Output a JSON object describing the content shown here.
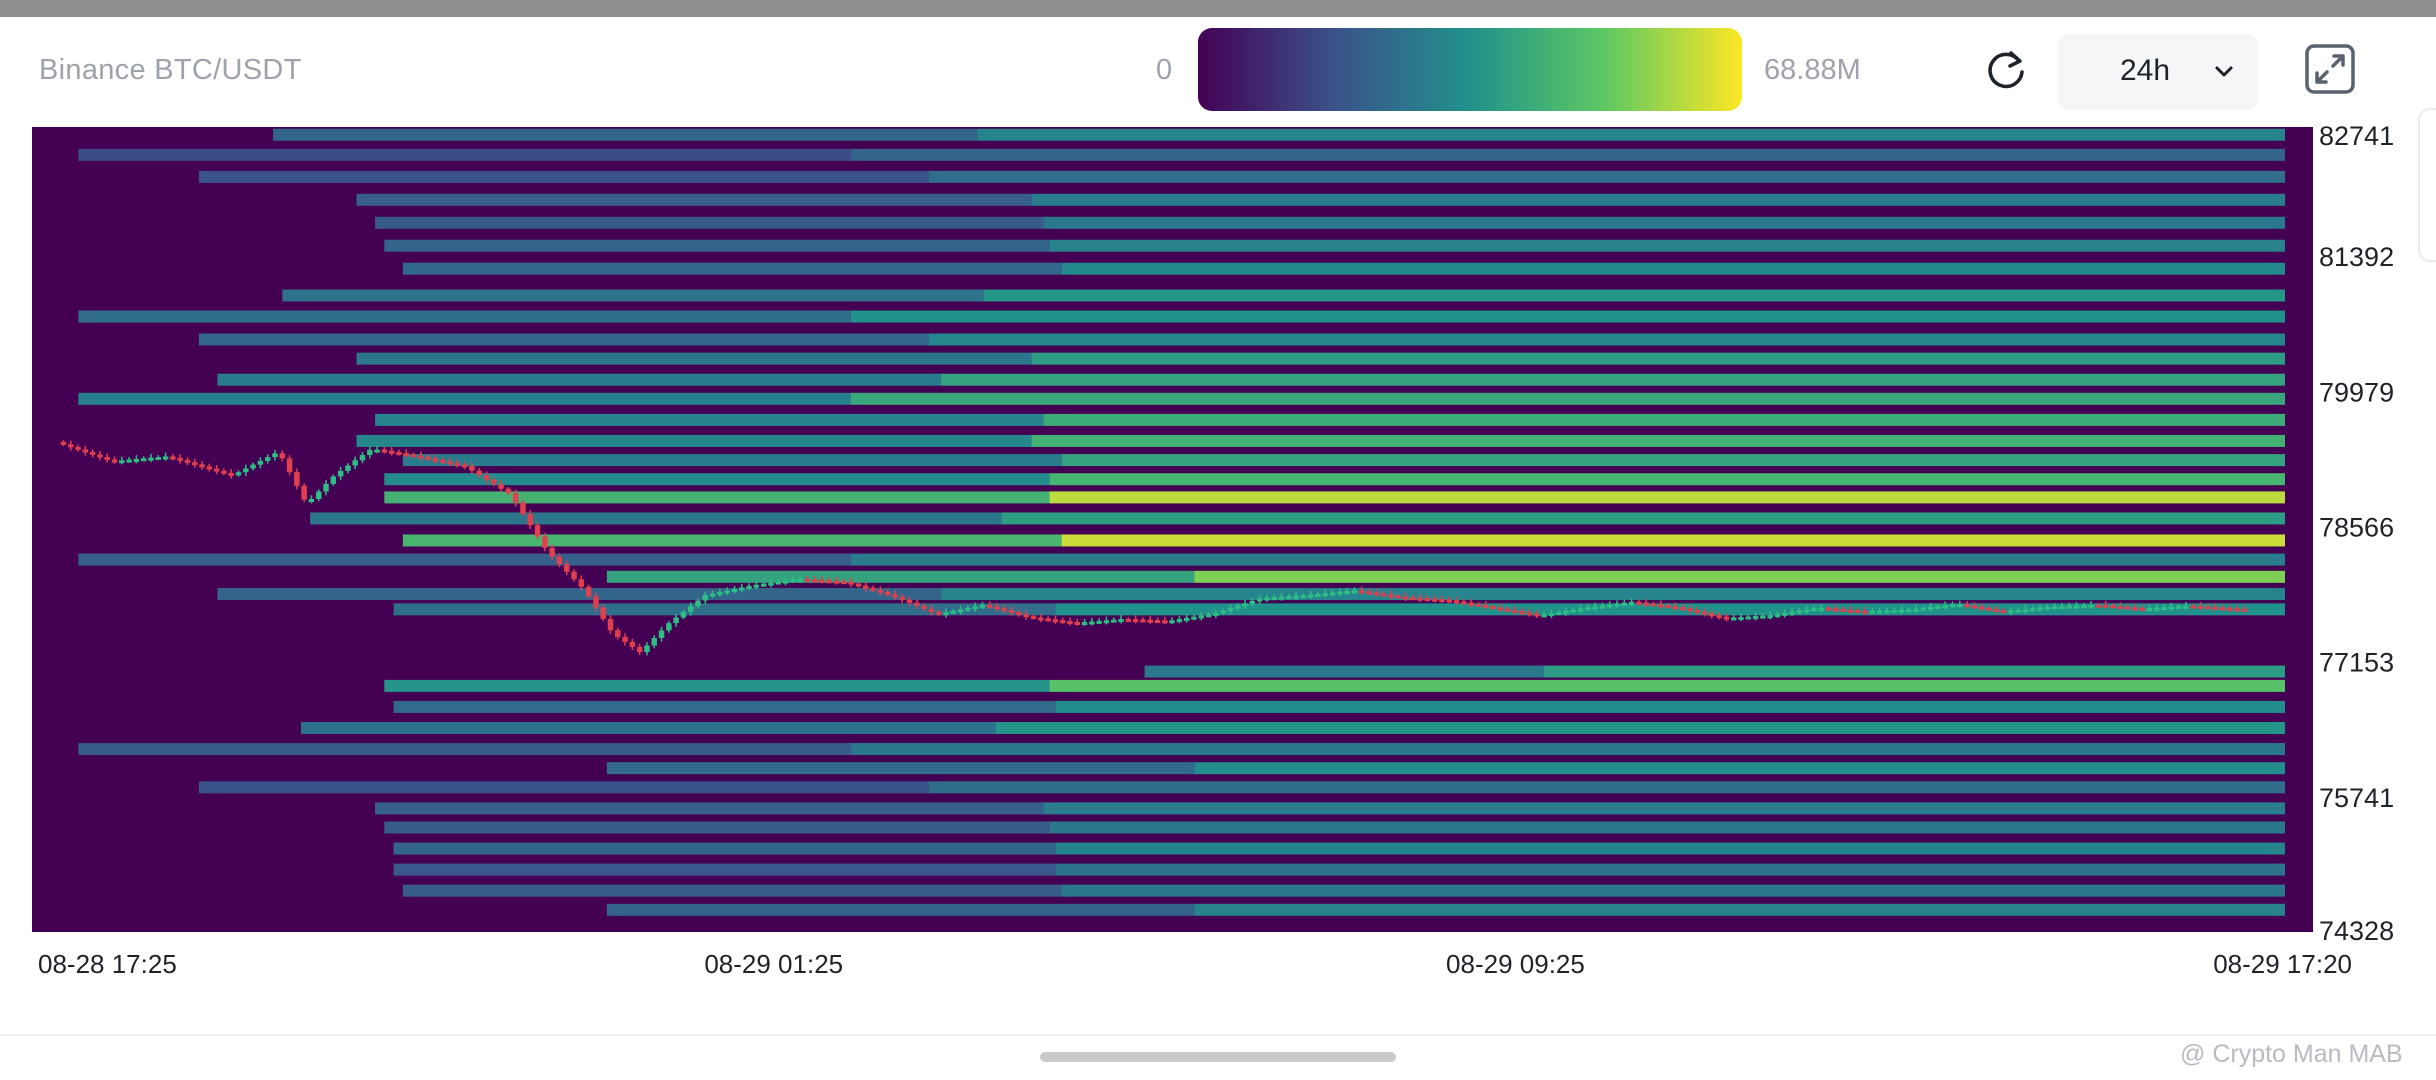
{
  "header": {
    "pair": "Binance BTC/USDT",
    "scale_min": "0",
    "scale_max": "68.88M",
    "range": "24h"
  },
  "watermark": "@ Crypto Man MAB",
  "colors": {
    "background": "#ffffff",
    "heatmap_base": "#440154",
    "up_candle": "#2ebd85",
    "down_candle": "#e0404e"
  },
  "icons": [
    "refresh-icon",
    "chevron-down-icon",
    "fullscreen-icon"
  ],
  "chart_data": {
    "type": "heatmap",
    "title": "Binance BTC/USDT",
    "colorscale": [
      "#440154",
      "#3b528b",
      "#21918c",
      "#5ec962",
      "#fde725"
    ],
    "value_range": [
      0,
      68.88
    ],
    "value_unit": "M",
    "y_ticks": [
      82741,
      81392,
      79979,
      78566,
      77153,
      75741,
      74328
    ],
    "ylim": [
      74328,
      82741
    ],
    "x_ticks": [
      "08-28 17:25",
      "08-29 01:25",
      "08-29 09:25",
      "08-29 17:20"
    ],
    "x_tick_hours": [
      0,
      8,
      16,
      23.917
    ],
    "xlim_hours": [
      0,
      24.3
    ],
    "liquidity_bands": [
      {
        "price": 82660,
        "start_h": 2.6,
        "intensity": 0.45
      },
      {
        "price": 82450,
        "start_h": 0.5,
        "intensity": 0.32
      },
      {
        "price": 82220,
        "start_h": 1.8,
        "intensity": 0.36
      },
      {
        "price": 81980,
        "start_h": 3.5,
        "intensity": 0.42
      },
      {
        "price": 81740,
        "start_h": 3.7,
        "intensity": 0.4
      },
      {
        "price": 81500,
        "start_h": 3.8,
        "intensity": 0.44
      },
      {
        "price": 81260,
        "start_h": 4.0,
        "intensity": 0.47
      },
      {
        "price": 80980,
        "start_h": 2.7,
        "intensity": 0.52
      },
      {
        "price": 80760,
        "start_h": 0.5,
        "intensity": 0.5
      },
      {
        "price": 80520,
        "start_h": 1.8,
        "intensity": 0.46
      },
      {
        "price": 80320,
        "start_h": 3.5,
        "intensity": 0.55
      },
      {
        "price": 80100,
        "start_h": 2.0,
        "intensity": 0.58
      },
      {
        "price": 79900,
        "start_h": 0.5,
        "intensity": 0.6
      },
      {
        "price": 79680,
        "start_h": 3.7,
        "intensity": 0.62
      },
      {
        "price": 79460,
        "start_h": 3.5,
        "intensity": 0.64
      },
      {
        "price": 79260,
        "start_h": 4.0,
        "intensity": 0.58
      },
      {
        "price": 79060,
        "start_h": 3.8,
        "intensity": 0.66
      },
      {
        "price": 78870,
        "start_h": 3.8,
        "intensity": 0.9
      },
      {
        "price": 78650,
        "start_h": 3.0,
        "intensity": 0.55
      },
      {
        "price": 78420,
        "start_h": 4.0,
        "intensity": 0.92
      },
      {
        "price": 78220,
        "start_h": 0.5,
        "intensity": 0.42
      },
      {
        "price": 78040,
        "start_h": 6.2,
        "intensity": 0.8
      },
      {
        "price": 77860,
        "start_h": 2.0,
        "intensity": 0.45
      },
      {
        "price": 77700,
        "start_h": 3.9,
        "intensity": 0.5
      },
      {
        "price": 77050,
        "start_h": 12.0,
        "intensity": 0.55
      },
      {
        "price": 76900,
        "start_h": 3.8,
        "intensity": 0.72
      },
      {
        "price": 76680,
        "start_h": 3.9,
        "intensity": 0.48
      },
      {
        "price": 76460,
        "start_h": 2.9,
        "intensity": 0.52
      },
      {
        "price": 76240,
        "start_h": 0.5,
        "intensity": 0.4
      },
      {
        "price": 76040,
        "start_h": 6.2,
        "intensity": 0.48
      },
      {
        "price": 75840,
        "start_h": 1.8,
        "intensity": 0.36
      },
      {
        "price": 75620,
        "start_h": 3.7,
        "intensity": 0.42
      },
      {
        "price": 75420,
        "start_h": 3.8,
        "intensity": 0.4
      },
      {
        "price": 75200,
        "start_h": 3.9,
        "intensity": 0.45
      },
      {
        "price": 74980,
        "start_h": 3.9,
        "intensity": 0.38
      },
      {
        "price": 74760,
        "start_h": 4.0,
        "intensity": 0.4
      },
      {
        "price": 74560,
        "start_h": 6.2,
        "intensity": 0.44
      }
    ],
    "price_series": [
      {
        "t": 0.3,
        "p": 79450
      },
      {
        "t": 0.9,
        "p": 79250
      },
      {
        "t": 1.5,
        "p": 79300
      },
      {
        "t": 2.2,
        "p": 79100
      },
      {
        "t": 2.7,
        "p": 79350
      },
      {
        "t": 3.0,
        "p": 78800
      },
      {
        "t": 3.3,
        "p": 79100
      },
      {
        "t": 3.7,
        "p": 79380
      },
      {
        "t": 4.2,
        "p": 79300
      },
      {
        "t": 4.7,
        "p": 79200
      },
      {
        "t": 5.2,
        "p": 78900
      },
      {
        "t": 5.6,
        "p": 78300
      },
      {
        "t": 6.0,
        "p": 77900
      },
      {
        "t": 6.3,
        "p": 77450
      },
      {
        "t": 6.6,
        "p": 77250
      },
      {
        "t": 6.9,
        "p": 77550
      },
      {
        "t": 7.3,
        "p": 77850
      },
      {
        "t": 7.8,
        "p": 77950
      },
      {
        "t": 8.3,
        "p": 78020
      },
      {
        "t": 8.8,
        "p": 77990
      },
      {
        "t": 9.3,
        "p": 77850
      },
      {
        "t": 9.8,
        "p": 77650
      },
      {
        "t": 10.3,
        "p": 77750
      },
      {
        "t": 10.8,
        "p": 77620
      },
      {
        "t": 11.3,
        "p": 77560
      },
      {
        "t": 11.8,
        "p": 77600
      },
      {
        "t": 12.3,
        "p": 77580
      },
      {
        "t": 12.8,
        "p": 77660
      },
      {
        "t": 13.3,
        "p": 77820
      },
      {
        "t": 13.8,
        "p": 77850
      },
      {
        "t": 14.3,
        "p": 77900
      },
      {
        "t": 14.8,
        "p": 77830
      },
      {
        "t": 15.3,
        "p": 77800
      },
      {
        "t": 15.8,
        "p": 77720
      },
      {
        "t": 16.3,
        "p": 77640
      },
      {
        "t": 16.8,
        "p": 77720
      },
      {
        "t": 17.3,
        "p": 77780
      },
      {
        "t": 17.8,
        "p": 77720
      },
      {
        "t": 18.3,
        "p": 77610
      },
      {
        "t": 18.8,
        "p": 77640
      },
      {
        "t": 19.3,
        "p": 77720
      },
      {
        "t": 19.8,
        "p": 77680
      },
      {
        "t": 20.3,
        "p": 77700
      },
      {
        "t": 20.8,
        "p": 77760
      },
      {
        "t": 21.3,
        "p": 77680
      },
      {
        "t": 21.8,
        "p": 77730
      },
      {
        "t": 22.3,
        "p": 77750
      },
      {
        "t": 22.8,
        "p": 77710
      },
      {
        "t": 23.3,
        "p": 77740
      },
      {
        "t": 23.9,
        "p": 77700
      }
    ]
  }
}
